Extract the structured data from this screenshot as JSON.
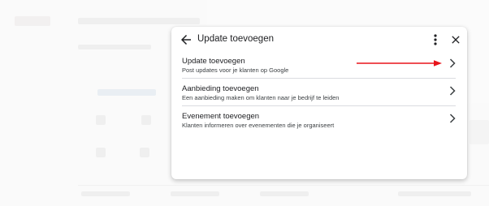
{
  "dialog": {
    "title": "Update toevoegen",
    "options": [
      {
        "title": "Update toevoegen",
        "subtitle": "Post updates voor je klanten op Google"
      },
      {
        "title": "Aanbieding toevoegen",
        "subtitle": "Een aanbieding maken om klanten naar je bedrijf te leiden"
      },
      {
        "title": "Evenement toevoegen",
        "subtitle": "Klanten informeren over evenementen die je organiseert"
      }
    ]
  },
  "icons": {
    "back": "arrow-back-icon",
    "more": "more-vert-icon",
    "close": "close-icon",
    "chevron": "chevron-right-icon"
  },
  "colors": {
    "annotation_arrow": "#e8141b",
    "text_primary": "#202124",
    "text_secondary": "#3c4043",
    "divider": "#dadce0"
  }
}
